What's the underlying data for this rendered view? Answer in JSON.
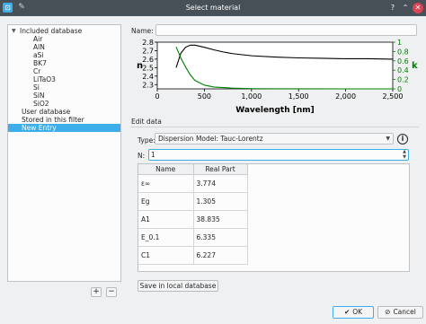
{
  "window": {
    "title": "Select material",
    "icons": {
      "app": "app-icon",
      "pin": "pin-icon",
      "help": "help-icon",
      "maximize": "maximize-icon",
      "close": "close-icon"
    },
    "glyphs": {
      "app": "⊡",
      "pin": "✎",
      "help": "?",
      "maximize": "⌃",
      "close": "✕"
    }
  },
  "tree": {
    "root_label": "Included database",
    "root_icon": "collapse-arrow-icon",
    "children": [
      "Air",
      "AlN",
      "aSi",
      "BK7",
      "Cr",
      "LiTaO3",
      "Si",
      "SiN",
      "SiO2"
    ],
    "user_database": "User database",
    "stored_filter": "Stored in this filter",
    "new_entry": "New Entry",
    "add_button": "+",
    "remove_button": "−"
  },
  "name_field": {
    "label": "Name:",
    "value": ""
  },
  "chart_data": {
    "type": "line",
    "xlabel": "Wavelength [nm]",
    "ylabel_left": "n",
    "ylabel_right": "k",
    "xlim": [
      0,
      2500
    ],
    "xticks": [
      "0",
      "500",
      "1,000",
      "1,500",
      "2,000",
      "2,500"
    ],
    "ylim_left": [
      2.25,
      2.8
    ],
    "yticks_left": [
      "2.3",
      "2.4",
      "2.5",
      "2.6",
      "2.7",
      "2.8"
    ],
    "ylim_right": [
      0,
      1
    ],
    "yticks_right": [
      "0",
      "0.2",
      "0.4",
      "0.6",
      "0.8",
      "1"
    ],
    "series": [
      {
        "name": "",
        "axis": "left",
        "color": "#000000",
        "x": [
          200,
          250,
          300,
          350,
          400,
          500,
          600,
          700,
          800,
          1000,
          1250,
          1500,
          1750,
          2000,
          2250,
          2500
        ],
        "y": [
          2.5,
          2.67,
          2.74,
          2.765,
          2.765,
          2.74,
          2.71,
          2.685,
          2.665,
          2.64,
          2.625,
          2.615,
          2.61,
          2.605,
          2.605,
          2.6
        ]
      },
      {
        "name": "",
        "axis": "right",
        "color": "#008000",
        "x": [
          200,
          250,
          300,
          350,
          400,
          500,
          600,
          800,
          1000,
          1250,
          1500,
          2000,
          2500
        ],
        "y": [
          0.9,
          0.66,
          0.47,
          0.3,
          0.18,
          0.08,
          0.04,
          0.015,
          0.005,
          0.002,
          0.001,
          0.0,
          0.0
        ]
      }
    ]
  },
  "edit_data": {
    "group_label": "Edit data",
    "type_label": "Type:",
    "type_value": "Dispersion Model: Tauc-Lorentz",
    "info_icon": "info-icon",
    "info_glyph": "i",
    "n_label": "N:",
    "n_value": "1",
    "table": {
      "headers": [
        "Name",
        "Real Part"
      ],
      "rows": [
        [
          "ε∞",
          "3.774"
        ],
        [
          "Eg",
          "1.305"
        ],
        [
          "A1",
          "38.835"
        ],
        [
          "E_0.1",
          "6.335"
        ],
        [
          "C1",
          "6.227"
        ]
      ]
    },
    "save_button": "Save in local database"
  },
  "footer": {
    "ok_label": "OK",
    "ok_icon": "checkmark-icon",
    "ok_glyph": "✔",
    "cancel_label": "Cancel",
    "cancel_icon": "cancel-icon",
    "cancel_glyph": "⊘"
  }
}
